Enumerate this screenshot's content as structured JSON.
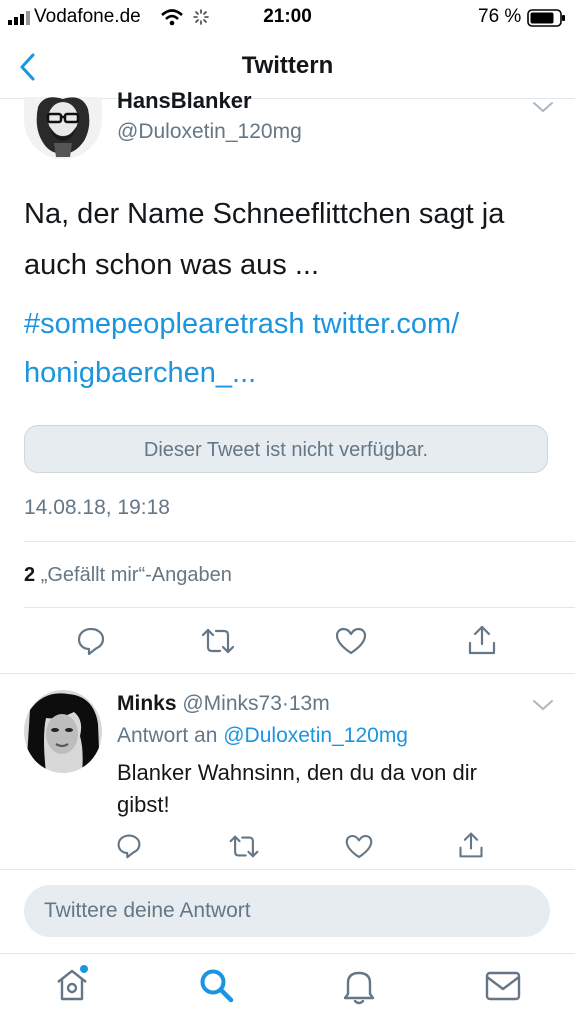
{
  "status_bar": {
    "carrier": "Vodafone.de",
    "time": "21:00",
    "battery": "76 %"
  },
  "nav": {
    "title": "Twittern"
  },
  "tweet": {
    "author_name": "HansBlanker",
    "author_handle": "@Duloxetin_120mg",
    "text_line1": "Na, der Name Schneeflittchen sagt ja",
    "text_line2": "auch schon was aus ...",
    "hashtag": "#somepeoplearetrash",
    "link_part1": "twitter.com/",
    "link_part2": "honigbaerchen_...",
    "quoted_unavailable": "Dieser Tweet ist nicht verfügbar.",
    "timestamp": "14.08.18, 19:18",
    "likes_count": "2",
    "likes_label": "„Gefällt mir“-Angaben"
  },
  "reply": {
    "author_name": "Minks",
    "author_handle": "@Minks73",
    "separator": "·",
    "age": "13m",
    "reply_to_label": "Antwort an",
    "reply_to_handle": "@Duloxetin_120mg",
    "text_line1": "Blanker Wahnsinn, den du da von dir",
    "text_line2": "gibst!"
  },
  "composer": {
    "placeholder": "Twittere deine Antwort"
  },
  "tab_bar": {
    "items": [
      "home-icon",
      "search-icon",
      "notifications-icon",
      "messages-icon"
    ],
    "active": "search-icon"
  },
  "colors": {
    "accent": "#1b95e0",
    "secondary_text": "#657786",
    "divider": "#e1e8ed"
  }
}
